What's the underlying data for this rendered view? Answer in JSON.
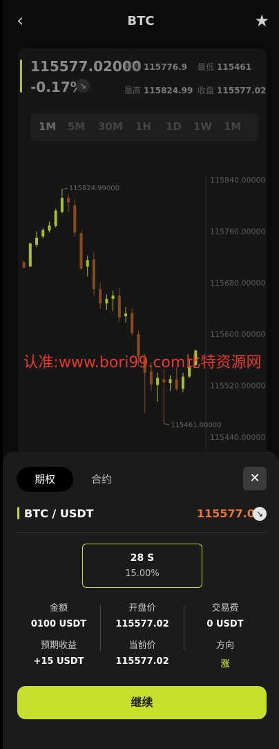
{
  "header": {
    "back_glyph": "‹",
    "title": "BTC",
    "star_glyph": "★"
  },
  "ticker": {
    "price": "115577.02000",
    "change": "-0.17%",
    "change_icon": "arrow-down-right-icon",
    "open_label": "开盘",
    "open_value": "115776.9",
    "low_label": "最低",
    "low_value": "115461",
    "high_label": "最高",
    "high_value": "115824.99",
    "close_label": "收盘",
    "close_value": "115577.02"
  },
  "timeframes": [
    "1M",
    "5M",
    "30M",
    "1H",
    "1D",
    "1W",
    "1M"
  ],
  "chart_data": {
    "type": "candlestick",
    "y_ticks": [
      "115840.00000",
      "115760.00000",
      "115680.00000",
      "115600.00000",
      "115520.00000",
      "115440.00000"
    ],
    "ylim": [
      115440,
      115840
    ],
    "annotations": [
      "115824.99000",
      "115461.00000"
    ],
    "candles": [
      {
        "o": 115712,
        "h": 115714,
        "l": 115703,
        "c": 115703
      },
      {
        "o": 115705,
        "h": 115742,
        "l": 115705,
        "c": 115741
      },
      {
        "o": 115739,
        "h": 115760,
        "l": 115735,
        "c": 115750
      },
      {
        "o": 115752,
        "h": 115765,
        "l": 115749,
        "c": 115762
      },
      {
        "o": 115761,
        "h": 115775,
        "l": 115758,
        "c": 115769
      },
      {
        "o": 115768,
        "h": 115795,
        "l": 115766,
        "c": 115792
      },
      {
        "o": 115790,
        "h": 115825,
        "l": 115788,
        "c": 115812
      },
      {
        "o": 115812,
        "h": 115818,
        "l": 115790,
        "c": 115805
      },
      {
        "o": 115800,
        "h": 115810,
        "l": 115752,
        "c": 115758
      },
      {
        "o": 115757,
        "h": 115762,
        "l": 115700,
        "c": 115702
      },
      {
        "o": 115705,
        "h": 115722,
        "l": 115690,
        "c": 115715
      },
      {
        "o": 115716,
        "h": 115728,
        "l": 115660,
        "c": 115670
      },
      {
        "o": 115670,
        "h": 115680,
        "l": 115640,
        "c": 115648
      },
      {
        "o": 115648,
        "h": 115662,
        "l": 115638,
        "c": 115655
      },
      {
        "o": 115655,
        "h": 115668,
        "l": 115636,
        "c": 115660
      },
      {
        "o": 115660,
        "h": 115672,
        "l": 115620,
        "c": 115626
      },
      {
        "o": 115628,
        "h": 115642,
        "l": 115618,
        "c": 115632
      },
      {
        "o": 115633,
        "h": 115640,
        "l": 115598,
        "c": 115602
      },
      {
        "o": 115600,
        "h": 115606,
        "l": 115550,
        "c": 115565
      },
      {
        "o": 115563,
        "h": 115570,
        "l": 115478,
        "c": 115540
      },
      {
        "o": 115542,
        "h": 115556,
        "l": 115513,
        "c": 115522
      },
      {
        "o": 115521,
        "h": 115540,
        "l": 115495,
        "c": 115532
      },
      {
        "o": 115530,
        "h": 115545,
        "l": 115461,
        "c": 115525
      },
      {
        "o": 115524,
        "h": 115536,
        "l": 115512,
        "c": 115530
      },
      {
        "o": 115530,
        "h": 115548,
        "l": 115512,
        "c": 115515
      },
      {
        "o": 115515,
        "h": 115540,
        "l": 115510,
        "c": 115534
      },
      {
        "o": 115534,
        "h": 115562,
        "l": 115532,
        "c": 115550
      },
      {
        "o": 115552,
        "h": 115575,
        "l": 115550,
        "c": 115575
      }
    ]
  },
  "watermark": "认准:www.bori99.com比特资源网",
  "sheet": {
    "tab_options": "期权",
    "tab_contract": "合约",
    "close_glyph": "✕",
    "pair": "BTC / USDT",
    "pair_price": "115577.02",
    "pair_icon": "arrow-down-right-icon",
    "duration": "28 S",
    "rate": "15.00%",
    "amount_label": "金额",
    "amount_value": "0100 USDT",
    "open_label": "开盘价",
    "open_value": "115577.02",
    "fee_label": "交易费",
    "fee_value": "0 USDT",
    "profit_label": "预期收益",
    "profit_value": "+15 USDT",
    "current_label": "当前价",
    "current_value": "115577.02",
    "direction_label": "方向",
    "direction_value": "涨",
    "continue_label": "继续"
  },
  "colors": {
    "accent": "#c5df2c",
    "up": "#a6c030",
    "down": "#8a4a1f",
    "price_orange": "#e9763a"
  }
}
